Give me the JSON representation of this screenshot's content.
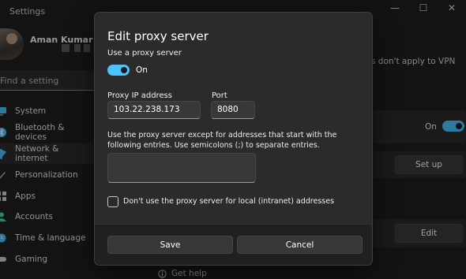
{
  "window": {
    "title": "Settings",
    "controls": [
      "—",
      "☐",
      "✕"
    ]
  },
  "user": {
    "name": "Aman Kumar"
  },
  "search": {
    "placeholder": "Find a setting"
  },
  "sidebar": {
    "items": [
      {
        "label": "System",
        "icon": "monitor-icon",
        "color": "#4cc2ff",
        "active": false
      },
      {
        "label": "Bluetooth & devices",
        "icon": "bluetooth-icon",
        "color": "#4cc2ff",
        "active": false
      },
      {
        "label": "Network & internet",
        "icon": "wifi-icon",
        "color": "#4cc2ff",
        "active": true
      },
      {
        "label": "Personalization",
        "icon": "brush-icon",
        "color": "#e8a87c",
        "active": false
      },
      {
        "label": "Apps",
        "icon": "apps-icon",
        "color": "#cfcfcf",
        "active": false
      },
      {
        "label": "Accounts",
        "icon": "person-icon",
        "color": "#4fd1a5",
        "active": false
      },
      {
        "label": "Time & language",
        "icon": "globe-clock-icon",
        "color": "#4cc2ff",
        "active": false
      },
      {
        "label": "Gaming",
        "icon": "controller-icon",
        "color": "#cfcfcf",
        "active": false
      }
    ]
  },
  "main": {
    "vpn_note": "s don't apply to VPN",
    "toggle_label": "On",
    "setup_button": "Set up",
    "edit_button": "Edit",
    "get_help": "Get help"
  },
  "dialog": {
    "title": "Edit proxy server",
    "use_proxy_label": "Use a proxy server",
    "toggle_state": "On",
    "ip_label": "Proxy IP address",
    "ip_value": "103.22.238.173",
    "port_label": "Port",
    "port_value": "8080",
    "exceptions_help": "Use the proxy server except for addresses that start with the following entries. Use semicolons (;) to separate entries.",
    "exceptions_value": "",
    "local_checkbox_label": "Don't use the proxy server for local (intranet) addresses",
    "save_label": "Save",
    "cancel_label": "Cancel"
  },
  "colors": {
    "accent": "#4cc2ff",
    "dialog_bg": "#2b2b2b",
    "footer_bg": "#202020"
  }
}
